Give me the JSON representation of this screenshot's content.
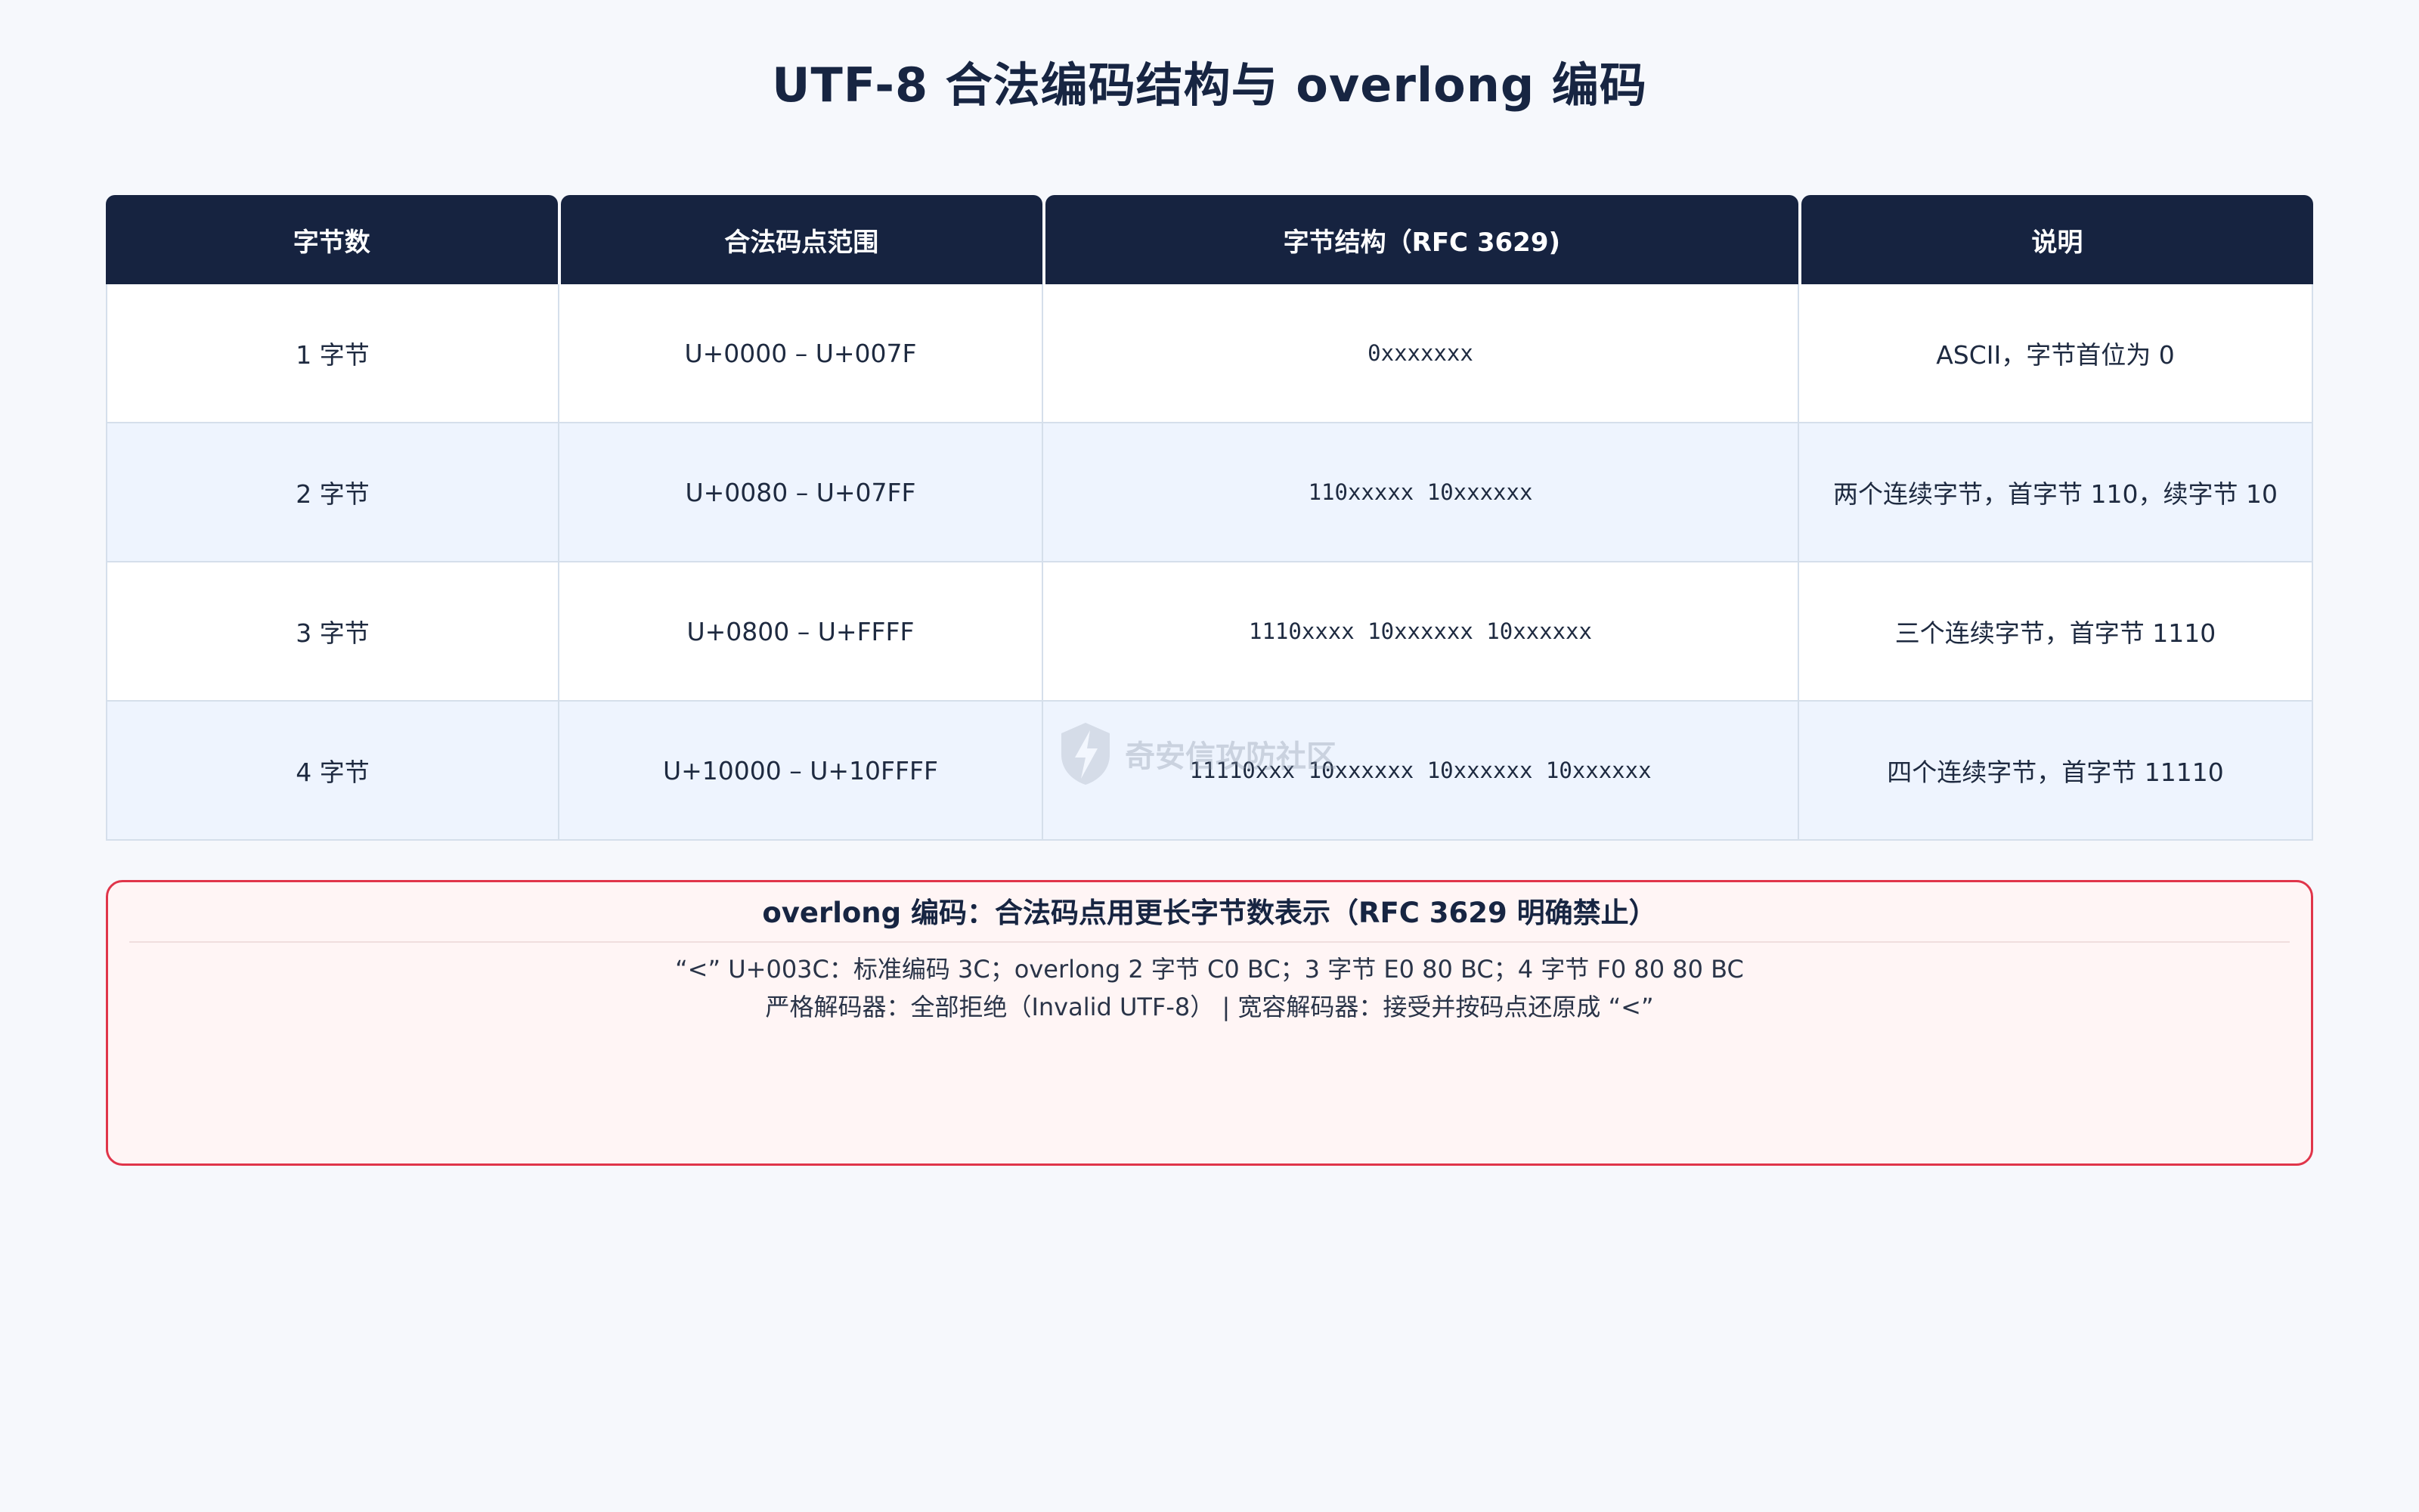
{
  "title": "UTF-8 合法编码结构与 overlong 编码",
  "table": {
    "headers": [
      "字节数",
      "合法码点范围",
      "字节结构（RFC 3629)",
      "说明"
    ],
    "rows": [
      {
        "bytes": "1 字节",
        "range": "U+0000 – U+007F",
        "structure": "0xxxxxxx",
        "note": "ASCII，字节首位为 0"
      },
      {
        "bytes": "2 字节",
        "range": "U+0080 – U+07FF",
        "structure": "110xxxxx 10xxxxxx",
        "note": "两个连续字节，首字节 110，续字节 10"
      },
      {
        "bytes": "3 字节",
        "range": "U+0800 – U+FFFF",
        "structure": "1110xxxx 10xxxxxx 10xxxxxx",
        "note": "三个连续字节，首字节 1110"
      },
      {
        "bytes": "4 字节",
        "range": "U+10000 – U+10FFFF",
        "structure": "11110xxx 10xxxxxx 10xxxxxx 10xxxxxx",
        "note": "四个连续字节，首字节 11110"
      }
    ]
  },
  "overlong": {
    "title": "overlong 编码：合法码点用更长字节数表示（RFC 3629 明确禁止）",
    "line1": "“<” U+003C：标准编码 3C；overlong 2 字节 C0 BC；3 字节 E0 80 BC；4 字节 F0 80 80 BC",
    "line2": "严格解码器：全部拒绝（Invalid UTF-8）  |  宽容解码器：接受并按码点还原成 “<”"
  },
  "watermark": {
    "text": "奇安信攻防社区",
    "icon": "bolt-shield-icon"
  }
}
